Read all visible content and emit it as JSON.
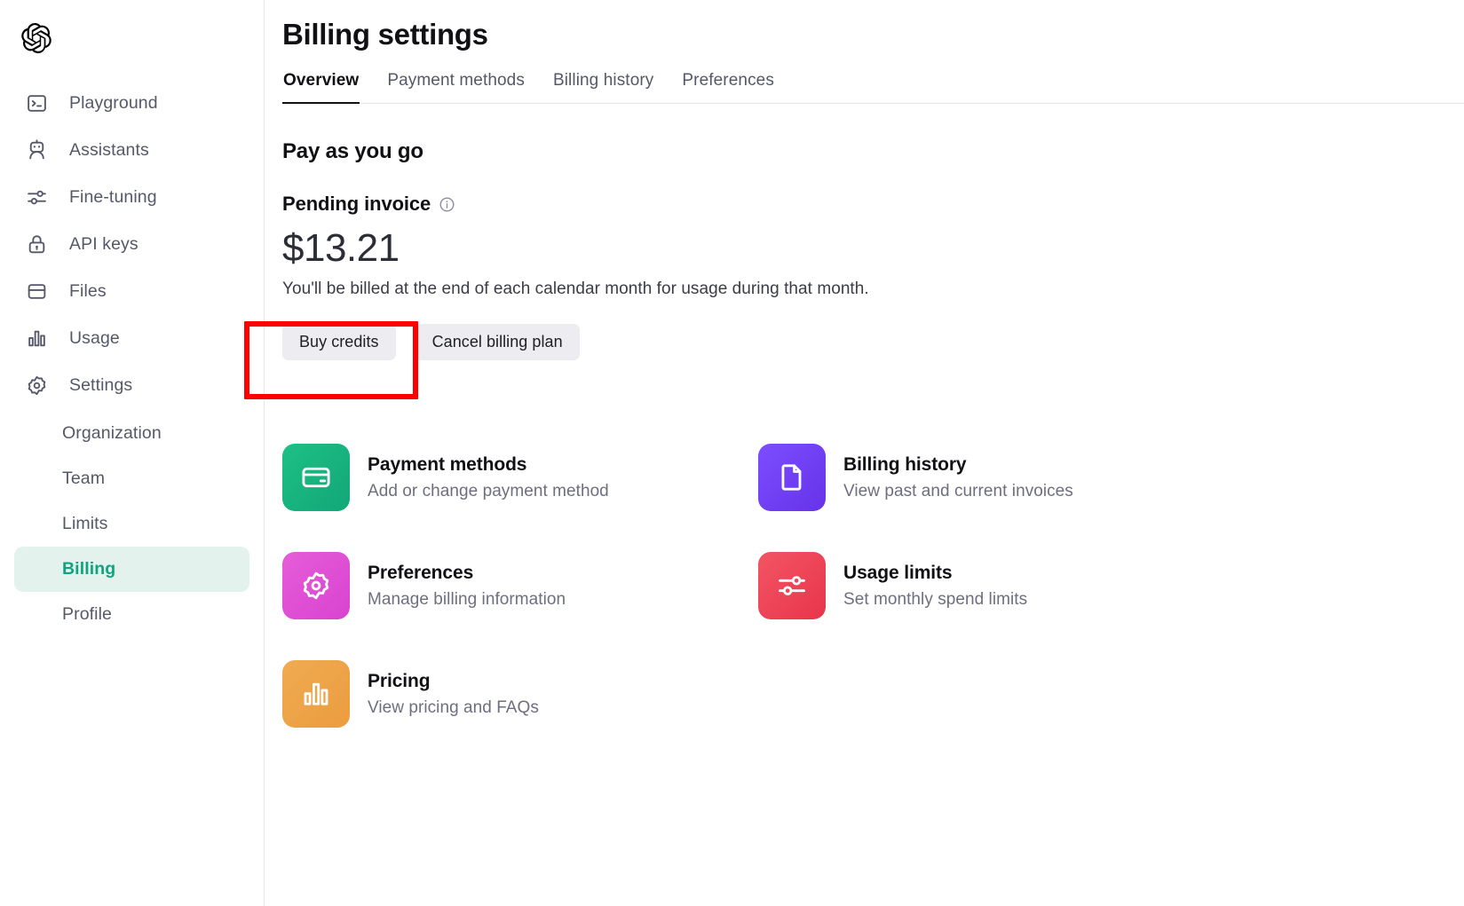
{
  "brand": {
    "logo": "openai-logo"
  },
  "sidebar": {
    "nav": [
      {
        "label": "Playground",
        "icon": "terminal-icon"
      },
      {
        "label": "Assistants",
        "icon": "robot-icon"
      },
      {
        "label": "Fine-tuning",
        "icon": "sliders-icon"
      },
      {
        "label": "API keys",
        "icon": "lock-icon"
      },
      {
        "label": "Files",
        "icon": "folder-icon"
      },
      {
        "label": "Usage",
        "icon": "bar-chart-icon"
      },
      {
        "label": "Settings",
        "icon": "gear-icon"
      }
    ],
    "sub_nav": [
      {
        "label": "Organization",
        "active": false
      },
      {
        "label": "Team",
        "active": false
      },
      {
        "label": "Limits",
        "active": false
      },
      {
        "label": "Billing",
        "active": true
      },
      {
        "label": "Profile",
        "active": false
      }
    ],
    "active_color": "#10a37f",
    "active_bg": "#e4f2ee"
  },
  "header": {
    "title": "Billing settings",
    "tabs": [
      {
        "label": "Overview",
        "active": true
      },
      {
        "label": "Payment methods",
        "active": false
      },
      {
        "label": "Billing history",
        "active": false
      },
      {
        "label": "Preferences",
        "active": false
      }
    ]
  },
  "billing": {
    "section_title": "Pay as you go",
    "pending_label": "Pending invoice",
    "pending_info_icon": "info-icon",
    "amount": "$13.21",
    "note": "You'll be billed at the end of each calendar month for usage during that month.",
    "buttons": [
      {
        "label": "Buy credits",
        "highlighted": true
      },
      {
        "label": "Cancel billing plan",
        "highlighted": false
      }
    ]
  },
  "cards": [
    {
      "title": "Payment methods",
      "subtitle": "Add or change payment method",
      "icon": "credit-card-icon",
      "color": "#12a777"
    },
    {
      "title": "Billing history",
      "subtitle": "View past and current invoices",
      "icon": "document-icon",
      "color": "#6633e8"
    },
    {
      "title": "Preferences",
      "subtitle": "Manage billing information",
      "icon": "gear-icon",
      "color": "#d943d0"
    },
    {
      "title": "Usage limits",
      "subtitle": "Set monthly spend limits",
      "icon": "sliders-icon",
      "color": "#e8354c"
    },
    {
      "title": "Pricing",
      "subtitle": "View pricing and FAQs",
      "icon": "bar-chart-icon",
      "color": "#eb9c3e"
    }
  ],
  "annotation": {
    "color": "#ff0000",
    "target": "Buy credits"
  }
}
